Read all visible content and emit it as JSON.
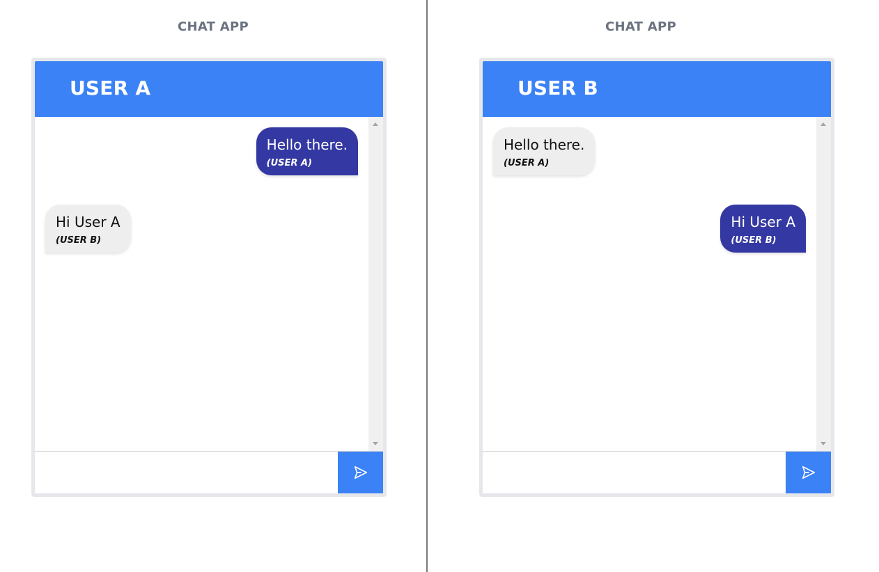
{
  "colors": {
    "header": "#3b82f6",
    "sent_bubble": "#3338a3",
    "received_bubble": "#eeeeee",
    "send_button": "#3b82f6",
    "divider": "#7a7a7a"
  },
  "panes": [
    {
      "app_title": "CHAT APP",
      "user_title": "USER A",
      "messages": [
        {
          "text": "Hello there.",
          "author": "(USER A)",
          "direction": "sent"
        },
        {
          "text": "Hi User A",
          "author": "(USER B)",
          "direction": "received"
        }
      ],
      "input": {
        "value": "",
        "placeholder": ""
      },
      "send_icon": "send-icon"
    },
    {
      "app_title": "CHAT APP",
      "user_title": "USER B",
      "messages": [
        {
          "text": "Hello there.",
          "author": "(USER A)",
          "direction": "received"
        },
        {
          "text": "Hi User A",
          "author": "(USER B)",
          "direction": "sent"
        }
      ],
      "input": {
        "value": "",
        "placeholder": ""
      },
      "send_icon": "send-icon"
    }
  ]
}
